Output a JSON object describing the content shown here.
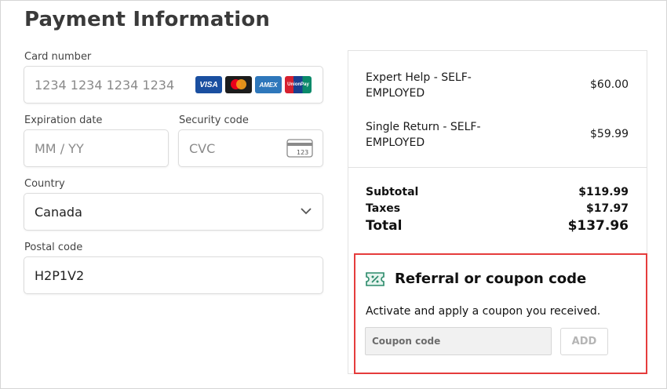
{
  "page": {
    "title": "Payment Information"
  },
  "form": {
    "card_number": {
      "label": "Card number",
      "placeholder": "1234 1234 1234 1234"
    },
    "card_brands": [
      {
        "name": "visa",
        "text": "VISA"
      },
      {
        "name": "mastercard",
        "text": ""
      },
      {
        "name": "amex",
        "text": "AMEX"
      },
      {
        "name": "unionpay",
        "text": "UnionPay"
      }
    ],
    "expiration": {
      "label": "Expiration date",
      "placeholder": "MM / YY"
    },
    "security": {
      "label": "Security code",
      "placeholder": "CVC",
      "icon_text": "123"
    },
    "country": {
      "label": "Country",
      "value": "Canada"
    },
    "postal": {
      "label": "Postal code",
      "value": "H2P1V2"
    }
  },
  "summary": {
    "items": [
      {
        "name": "Expert Help - SELF-EMPLOYED",
        "price": "$60.00"
      },
      {
        "name": "Single Return - SELF-EMPLOYED",
        "price": "$59.99"
      }
    ],
    "subtotal": {
      "label": "Subtotal",
      "value": "$119.99"
    },
    "taxes": {
      "label": "Taxes",
      "value": "$17.97"
    },
    "total": {
      "label": "Total",
      "value": "$137.96"
    }
  },
  "coupon": {
    "title": "Referral or coupon code",
    "description": "Activate and apply a coupon you received.",
    "placeholder": "Coupon code",
    "button": "ADD"
  },
  "colors": {
    "highlight_border": "#e53c3c",
    "coupon_icon": "#2a8a6a"
  }
}
